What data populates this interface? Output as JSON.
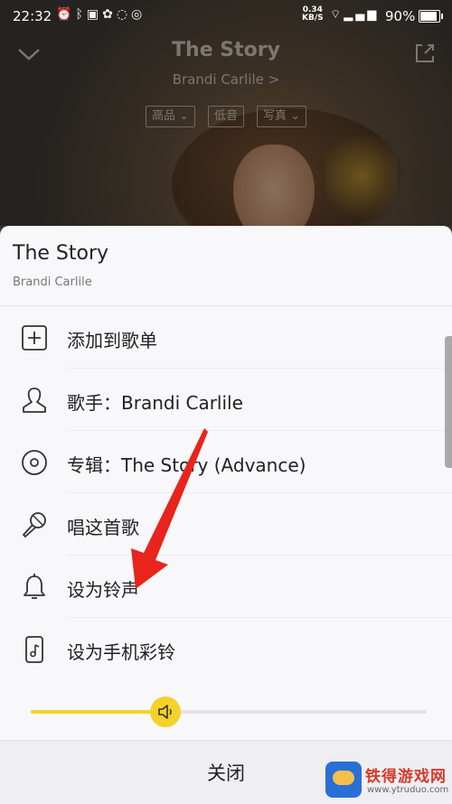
{
  "status_bar": {
    "time": "22:32",
    "speed_value": "0.34",
    "speed_unit": "KB/S",
    "battery": "90%",
    "icons": [
      "alarm-icon",
      "bluetooth-icon",
      "shield-icon",
      "app-icon",
      "qq-icon",
      "netease-icon",
      "wifi-icon",
      "signal-icon"
    ]
  },
  "player": {
    "title": "The Story",
    "artist": "Brandi Carlile",
    "artist_chevron": ">",
    "tags": [
      "高品",
      "低音",
      "写真"
    ]
  },
  "sheet": {
    "title": "The Story",
    "subtitle": "Brandi Carlile",
    "items": [
      {
        "label": "添加到歌单",
        "icon": "add-square-icon"
      },
      {
        "label": "歌手：Brandi Carlile",
        "icon": "person-icon"
      },
      {
        "label": "专辑：The Story (Advance)",
        "icon": "album-disc-icon"
      },
      {
        "label": "唱这首歌",
        "icon": "microphone-icon"
      },
      {
        "label": "设为铃声",
        "icon": "bell-icon"
      },
      {
        "label": "设为手机彩铃",
        "icon": "phone-ringtone-icon"
      }
    ],
    "volume_fraction": 0.34,
    "close_label": "关闭"
  },
  "colors": {
    "accent": "#f5d22b",
    "arrow": "#e8241c",
    "sheet_bg": "#f8f7f9"
  },
  "watermark": {
    "text": "铁得游戏网",
    "url": "www.ytruduo.com"
  }
}
